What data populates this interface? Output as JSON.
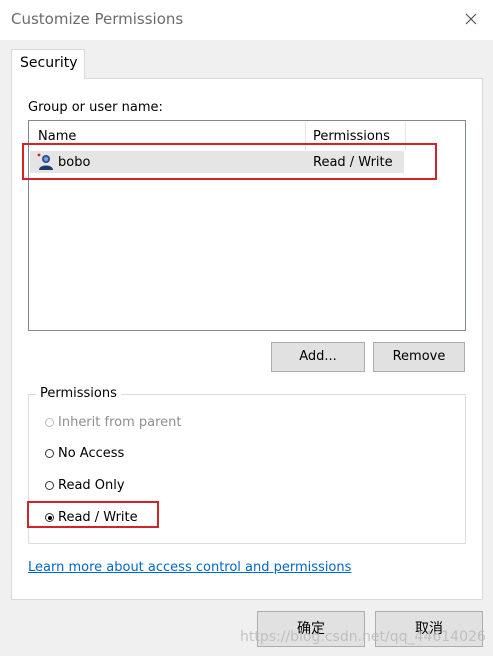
{
  "window": {
    "title": "Customize Permissions"
  },
  "tabs": [
    {
      "label": "Security"
    }
  ],
  "users": {
    "label": "Group or user name:",
    "columns": {
      "name": "Name",
      "permissions": "Permissions"
    },
    "rows": [
      {
        "name": "bobo",
        "permission": "Read / Write",
        "icon": "user-icon"
      }
    ],
    "add_label": "Add...",
    "remove_label": "Remove"
  },
  "permissions": {
    "legend": "Permissions",
    "options": [
      {
        "label": "Inherit from parent",
        "enabled": false,
        "checked": false
      },
      {
        "label": "No Access",
        "enabled": true,
        "checked": false
      },
      {
        "label": "Read Only",
        "enabled": true,
        "checked": false
      },
      {
        "label": "Read / Write",
        "enabled": true,
        "checked": true
      }
    ]
  },
  "help_link": "Learn more about access control and permissions",
  "footer": {
    "ok_label": "确定",
    "cancel_label": "取消"
  },
  "watermark": "https://blog.csdn.net/qq_44614026",
  "colors": {
    "highlight_border": "#d2232a",
    "link": "#0066cc"
  }
}
